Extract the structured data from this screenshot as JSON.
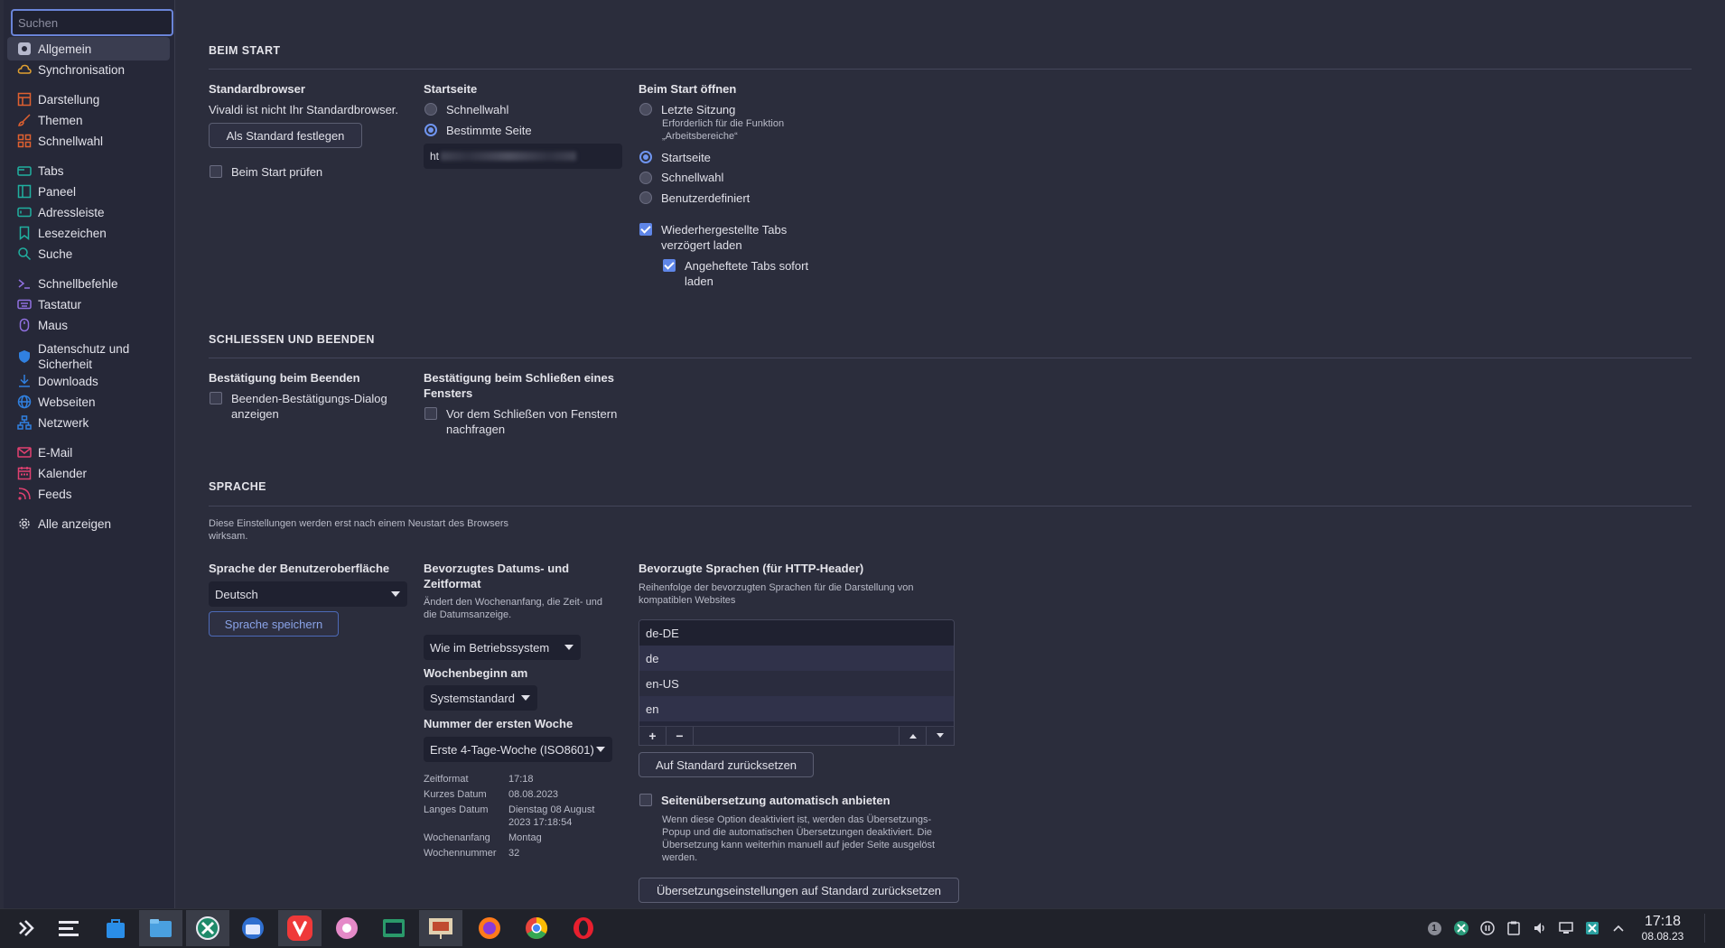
{
  "sidebar": {
    "search_placeholder": "Suchen",
    "items": [
      {
        "label": "Allgemein",
        "icon": "gear-settings-icon",
        "color": "#b5b8cc"
      },
      {
        "label": "Synchronisation",
        "icon": "cloud-icon",
        "color": "#e0a030"
      },
      {
        "label": "Darstellung",
        "icon": "layout-icon",
        "color": "#e06030"
      },
      {
        "label": "Themen",
        "icon": "brush-icon",
        "color": "#e06030"
      },
      {
        "label": "Schnellwahl",
        "icon": "grid-icon",
        "color": "#e06030"
      },
      {
        "label": "Tabs",
        "icon": "tab-icon",
        "color": "#20b0a0"
      },
      {
        "label": "Paneel",
        "icon": "panel-icon",
        "color": "#20b0a0"
      },
      {
        "label": "Adressleiste",
        "icon": "address-bar-icon",
        "color": "#20b0a0"
      },
      {
        "label": "Lesezeichen",
        "icon": "bookmark-icon",
        "color": "#20b0a0"
      },
      {
        "label": "Suche",
        "icon": "magnifier-icon",
        "color": "#20b0a0"
      },
      {
        "label": "Schnellbefehle",
        "icon": "command-icon",
        "color": "#9070e0"
      },
      {
        "label": "Tastatur",
        "icon": "keyboard-icon",
        "color": "#9070e0"
      },
      {
        "label": "Maus",
        "icon": "mouse-icon",
        "color": "#9070e0"
      },
      {
        "label": "Datenschutz und Sicherheit",
        "icon": "shield-icon",
        "color": "#3080e0"
      },
      {
        "label": "Downloads",
        "icon": "download-icon",
        "color": "#3080e0"
      },
      {
        "label": "Webseiten",
        "icon": "globe-icon",
        "color": "#3080e0"
      },
      {
        "label": "Netzwerk",
        "icon": "network-icon",
        "color": "#3080e0"
      },
      {
        "label": "E-Mail",
        "icon": "mail-icon",
        "color": "#e04070"
      },
      {
        "label": "Kalender",
        "icon": "calendar-icon",
        "color": "#e04070"
      },
      {
        "label": "Feeds",
        "icon": "rss-icon",
        "color": "#e04070"
      },
      {
        "label": "Alle anzeigen",
        "icon": "gear-icon",
        "color": "#d0d0d8"
      }
    ]
  },
  "beim_start": {
    "title": "BEIM START",
    "standardbrowser": {
      "heading": "Standardbrowser",
      "status": "Vivaldi ist nicht Ihr Standardbrowser.",
      "button": "Als Standard festlegen",
      "check_label": "Beim Start prüfen"
    },
    "startseite": {
      "heading": "Startseite",
      "opt_schnellwahl": "Schnellwahl",
      "opt_bestimmte": "Bestimmte Seite",
      "url_value": "ht"
    },
    "beim_start_oeffnen": {
      "heading": "Beim Start öffnen",
      "opt_letzte": "Letzte Sitzung",
      "letzte_note_1": "Erforderlich für die Funktion",
      "letzte_note_2": "„Arbeitsbereiche“",
      "opt_startseite": "Startseite",
      "opt_schnellwahl": "Schnellwahl",
      "opt_benutzer": "Benutzerdefiniert",
      "check_restored_1": "Wiederhergestellte Tabs",
      "check_restored_2": "verzögert laden",
      "check_pinned_1": "Angeheftete Tabs sofort",
      "check_pinned_2": "laden"
    }
  },
  "schliessen": {
    "title": "SCHLIESSEN UND BEENDEN",
    "beenden_heading": "Bestätigung beim Beenden",
    "beenden_check_1": "Beenden-Bestätigungs-Dialog",
    "beenden_check_2": "anzeigen",
    "fenster_heading_1": "Bestätigung beim Schließen eines",
    "fenster_heading_2": "Fensters",
    "fenster_check_1": "Vor dem Schließen von Fenstern",
    "fenster_check_2": "nachfragen"
  },
  "sprache": {
    "title": "SPRACHE",
    "note_1": "Diese Einstellungen werden erst nach einem Neustart des Browsers",
    "note_2": "wirksam.",
    "ui_heading": "Sprache der Benutzeroberfläche",
    "ui_value": "Deutsch",
    "save_button": "Sprache speichern",
    "date_heading_1": "Bevorzugtes Datums- und",
    "date_heading_2": "Zeitformat",
    "date_note_1": "Ändert den Wochenanfang, die Zeit- und",
    "date_note_2": "die Datumsanzeige.",
    "date_value": "Wie im Betriebssystem",
    "week_start_heading": "Wochenbeginn am",
    "week_start_value": "Systemstandard",
    "first_week_heading": "Nummer der ersten Woche",
    "first_week_value": "Erste 4-Tage-Woche (ISO8601)",
    "preview": [
      {
        "k": "Zeitformat",
        "v": "17:18"
      },
      {
        "k": "Kurzes Datum",
        "v": "08.08.2023"
      },
      {
        "k": "Langes Datum",
        "v": "Dienstag 08 August"
      },
      {
        "k": "",
        "v": "2023 17:18:54"
      },
      {
        "k": "Wochenanfang",
        "v": "Montag"
      },
      {
        "k": "Wochennummer",
        "v": "32"
      }
    ],
    "http_heading": "Bevorzugte Sprachen (für HTTP-Header)",
    "http_note_1": "Reihenfolge der bevorzugten Sprachen für die Darstellung von",
    "http_note_2": "kompatiblen Websites",
    "languages": [
      "de-DE",
      "de",
      "en-US",
      "en"
    ],
    "reset_button": "Auf Standard zurücksetzen",
    "translate_check": "Seitenübersetzung automatisch anbieten",
    "translate_note_1": "Wenn diese Option deaktiviert ist, werden das Übersetzungs-",
    "translate_note_2": "Popup und die automatischen Übersetzungen deaktiviert. Die",
    "translate_note_3": "Übersetzung kann weiterhin manuell auf jeder Seite ausgelöst",
    "translate_note_4": "werden.",
    "translate_reset_button": "Übersetzungseinstellungen auf Standard zurücksetzen"
  },
  "taskbar": {
    "apps": [
      "launcher-icon",
      "switcher-icon",
      "store-icon",
      "file-manager-icon",
      "xmind-icon",
      "thunderbird-icon",
      "vivaldi-icon",
      "app-icon",
      "terminal-icon",
      "presentation-icon",
      "firefox-icon",
      "chrome-icon",
      "opera-icon"
    ],
    "badge": "1",
    "time": "17:18",
    "date": "08.08.23"
  }
}
